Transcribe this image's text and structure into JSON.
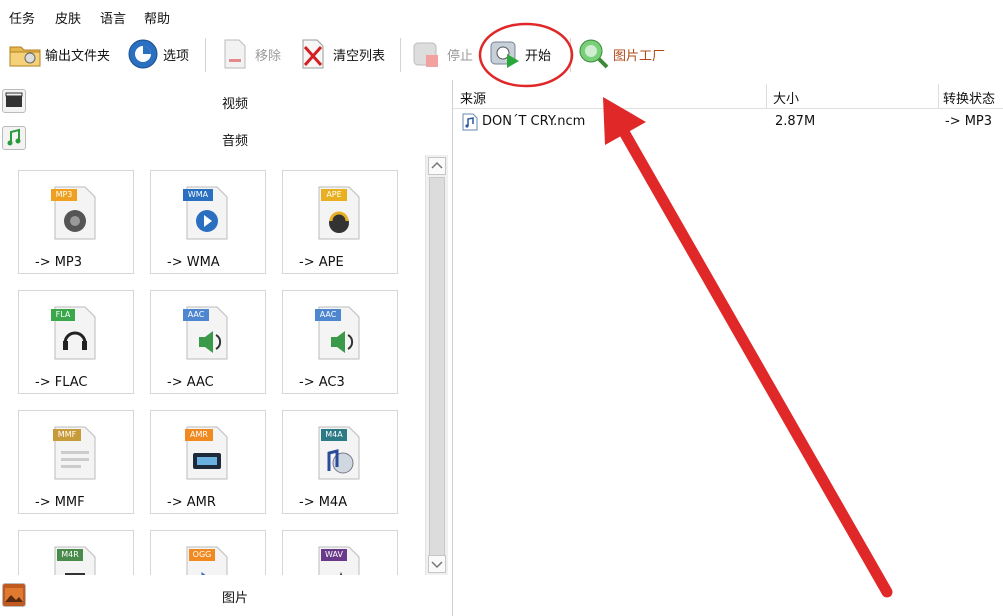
{
  "menu": {
    "items": [
      "任务",
      "皮肤",
      "语言",
      "帮助"
    ]
  },
  "toolbar": {
    "output_folder": "输出文件夹",
    "options": "选项",
    "remove": "移除",
    "clear_list": "清空列表",
    "stop": "停止",
    "start": "开始",
    "picture_factory": "图片工厂"
  },
  "categories": {
    "video": "视频",
    "audio": "音频",
    "picture": "图片"
  },
  "formats": [
    {
      "badge": "MP3",
      "label": "-> MP3",
      "color": "#f0a020"
    },
    {
      "badge": "WMA",
      "label": "-> WMA",
      "color": "#2a6fc0"
    },
    {
      "badge": "APE",
      "label": "-> APE",
      "color": "#e8b020"
    },
    {
      "badge": "FLA",
      "label": "-> FLAC",
      "color": "#3aa84a"
    },
    {
      "badge": "AAC",
      "label": "-> AAC",
      "color": "#4f86d0"
    },
    {
      "badge": "AAC",
      "label": "-> AC3",
      "color": "#4f86d0"
    },
    {
      "badge": "MMF",
      "label": "-> MMF",
      "color": "#c89b3a"
    },
    {
      "badge": "AMR",
      "label": "-> AMR",
      "color": "#f08a20"
    },
    {
      "badge": "M4A",
      "label": "-> M4A",
      "color": "#2b7a86"
    },
    {
      "badge": "M4R",
      "label": "",
      "color": "#4a8a4a"
    },
    {
      "badge": "OGG",
      "label": "",
      "color": "#f08a20"
    },
    {
      "badge": "WAV",
      "label": "",
      "color": "#6a3a8a"
    }
  ],
  "file_list": {
    "columns": [
      "来源",
      "大小",
      "转换状态"
    ],
    "rows": [
      {
        "name": "DON´T CRY.ncm",
        "size": "2.87M",
        "status": "-> MP3"
      }
    ]
  },
  "annotation_color": "#e02828"
}
